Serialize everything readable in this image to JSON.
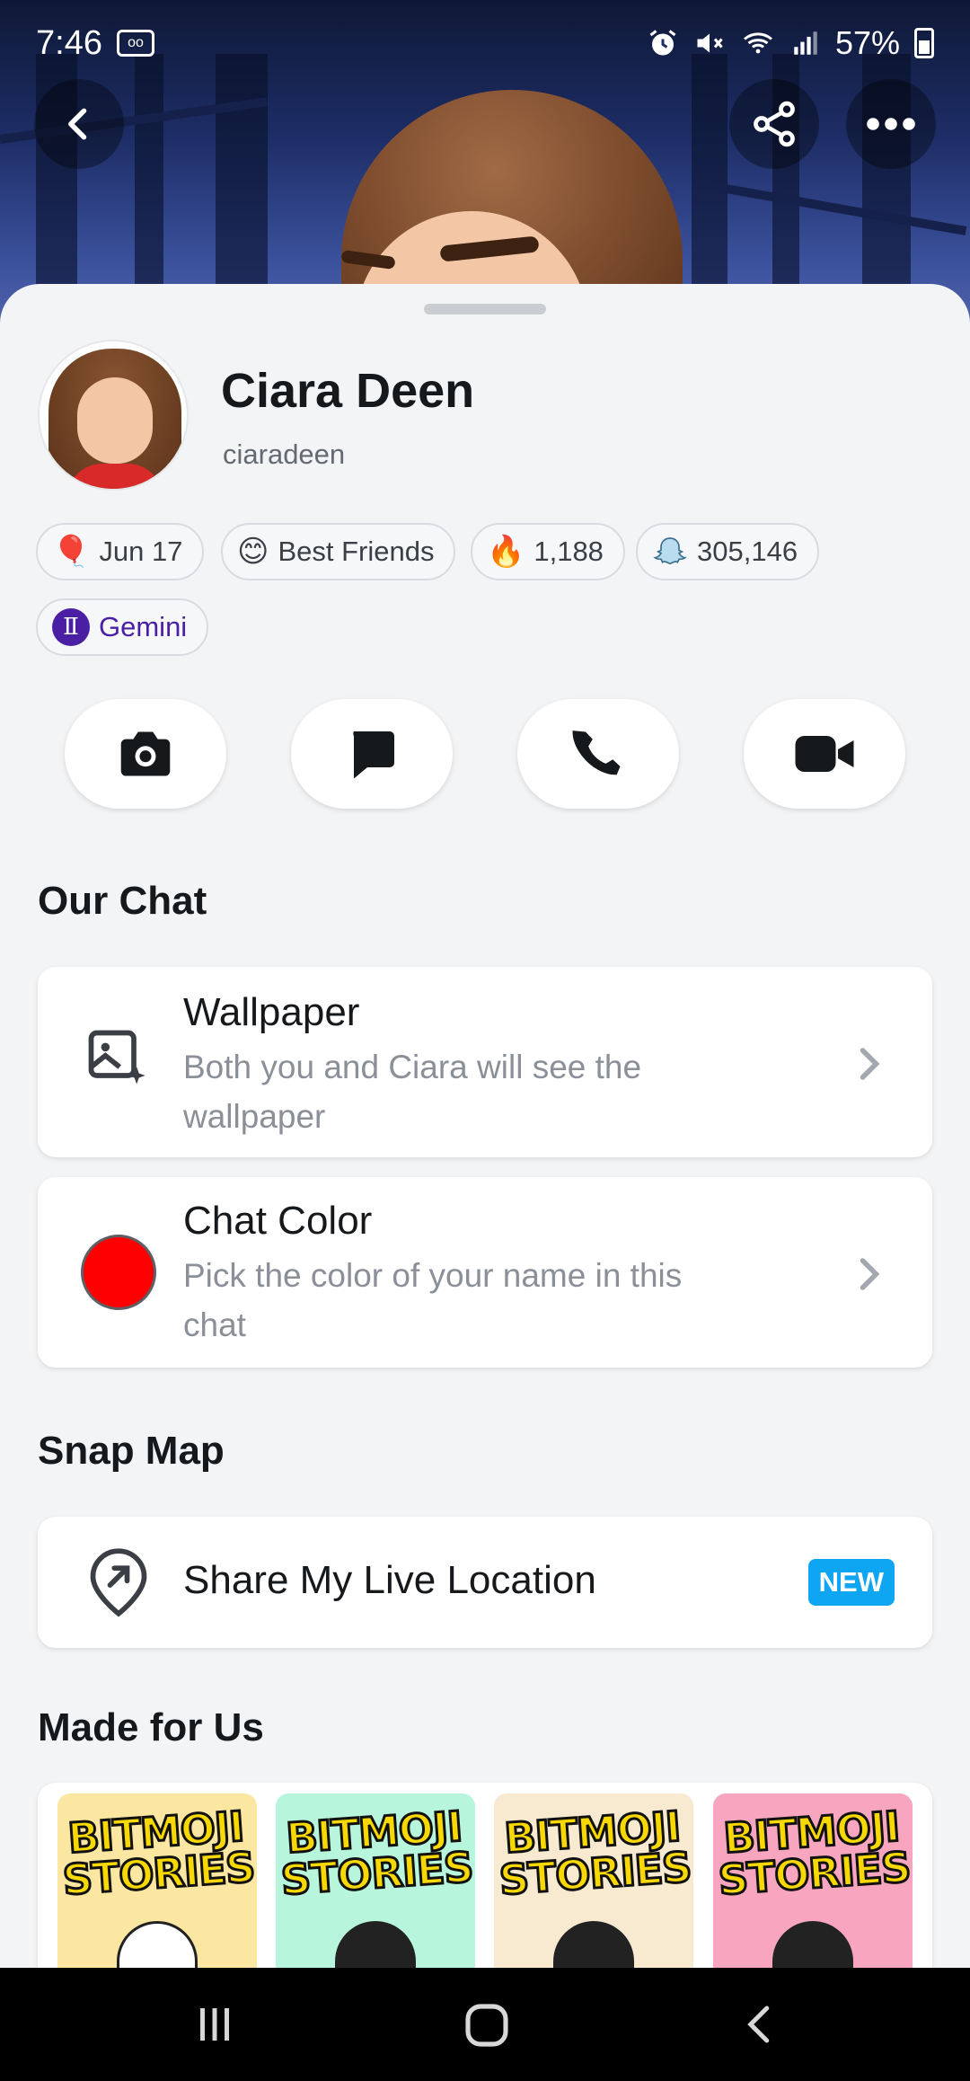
{
  "status_bar": {
    "time": "7:46",
    "voicemail_icon": "voicemail-icon",
    "battery": "57%",
    "icons": [
      "alarm-icon",
      "mute-icon",
      "wifi-icon",
      "signal-icon",
      "battery-icon"
    ]
  },
  "header": {
    "back_icon": "back-arrow-icon",
    "share_icon": "share-icon",
    "more_icon": "more-options-icon"
  },
  "profile": {
    "name": "Ciara Deen",
    "username": "ciaradeen",
    "chips": [
      {
        "icon": "balloon-icon",
        "label": "Jun 17"
      },
      {
        "icon": "smiling-face-icon",
        "label": "Best Friends"
      },
      {
        "icon": "fire-icon",
        "label": "1,188"
      },
      {
        "icon": "snap-score-icon",
        "label": "305,146"
      },
      {
        "icon": "gemini-icon",
        "label": "Gemini"
      }
    ]
  },
  "actions": [
    {
      "name": "camera-button",
      "icon": "camera-icon"
    },
    {
      "name": "chat-button",
      "icon": "chat-bubble-icon"
    },
    {
      "name": "call-button",
      "icon": "phone-icon"
    },
    {
      "name": "video-call-button",
      "icon": "video-camera-icon"
    }
  ],
  "our_chat": {
    "title": "Our Chat",
    "wallpaper": {
      "title": "Wallpaper",
      "subtitle": "Both you and Ciara will see the wallpaper"
    },
    "chat_color": {
      "title": "Chat Color",
      "subtitle": "Pick the color of your name in this chat",
      "color": "#ff0000"
    }
  },
  "snap_map": {
    "title": "Snap Map",
    "live_location": {
      "title": "Share My Live Location",
      "badge": "NEW"
    }
  },
  "made_for_us": {
    "title": "Made for Us",
    "stories": [
      {
        "label": "BITMOJI STORIES",
        "bg": "#fbe7a1"
      },
      {
        "label": "BITMOJI STORIES",
        "bg": "#b8f5dd"
      },
      {
        "label": "BITMOJI STORIES",
        "bg": "#f7ead0"
      },
      {
        "label": "BITMOJI STORIES",
        "bg": "#f8a6c0"
      }
    ]
  },
  "colors": {
    "accent_blue": "#0ea5f2",
    "gemini_purple": "#4b1fa3"
  }
}
